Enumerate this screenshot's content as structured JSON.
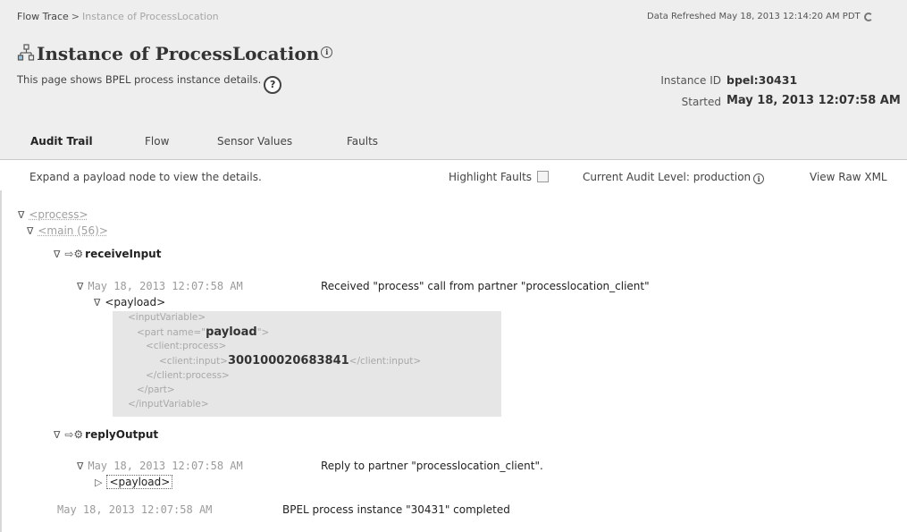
{
  "breadcrumb": {
    "root": "Flow Trace",
    "separator": ">",
    "current": "Instance of ProcessLocation"
  },
  "refresh": {
    "label": "Data Refreshed May 18, 2013 12:14:20 AM PDT"
  },
  "page": {
    "title": "Instance of ProcessLocation",
    "info_glyph": "i",
    "description": "This page shows BPEL process instance details.",
    "help_glyph": "?"
  },
  "instance": {
    "id_label": "Instance ID",
    "id_value": "bpel:30431",
    "started_label": "Started",
    "started_value": "May 18, 2013 12:07:58 AM"
  },
  "tabs": [
    {
      "label": "Audit Trail",
      "active": true
    },
    {
      "label": "Flow",
      "active": false
    },
    {
      "label": "Sensor Values",
      "active": false
    },
    {
      "label": "Faults",
      "active": false
    }
  ],
  "toolbar": {
    "hint": "Expand a payload node to view the details.",
    "highlight_faults": "Highlight Faults",
    "highlight_faults_checked": false,
    "audit_level": "Current Audit Level: production",
    "view_raw_xml": "View Raw XML"
  },
  "tree": {
    "process_tag": "<process>",
    "main_tag": "<main (56)>",
    "receive": {
      "name": "receiveInput",
      "timestamp": "May 18, 2013 12:07:58 AM",
      "message": "Received \"process\" call from partner \"processlocation_client\"",
      "payload_tag": "<payload>"
    },
    "xml": {
      "line1": "<inputVariable>",
      "line2_open": "<part  name=\"",
      "line2_name": "payload",
      "line2_close": "\">",
      "line3": "<client:process>",
      "line4_open": "<client:input>",
      "line4_value": "300100020683841",
      "line4_close": "</client:input>",
      "line5": "</client:process>",
      "line6": "</part>",
      "line7": "</inputVariable>"
    },
    "reply": {
      "name": "replyOutput",
      "timestamp": "May 18, 2013 12:07:58 AM",
      "message": "Reply to partner \"processlocation_client\".",
      "payload_tag": "<payload>"
    },
    "completed": {
      "timestamp": "May 18, 2013 12:07:58 AM",
      "message": "BPEL process instance \"30431\" completed"
    }
  },
  "glyphs": {
    "expanded": "∇",
    "collapsed": "▷",
    "gear": "⇨⚙"
  }
}
